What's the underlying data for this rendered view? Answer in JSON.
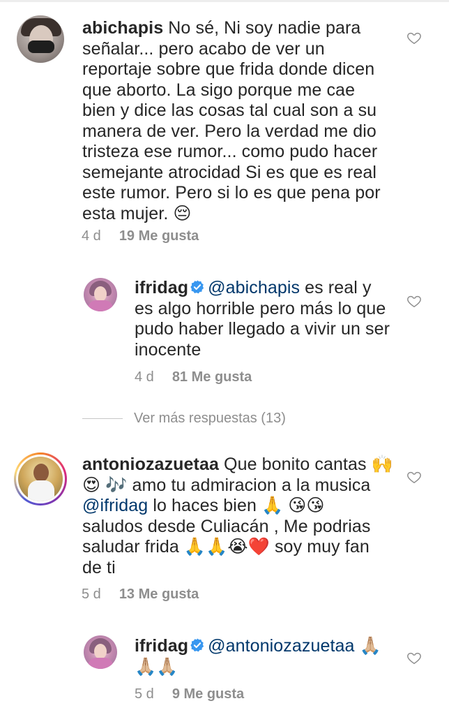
{
  "comments": [
    {
      "username": "abichapis",
      "text_lines": [
        "No sé,  Ni soy nadie para",
        "señalar... pero acabo de ver un",
        "reportaje sobre que frida donde dicen",
        "que aborto.  La sigo porque me cae",
        "bien y dice las cosas tal cual son a su",
        "manera de ver. Pero la verdad me dio",
        "tristeza ese rumor... como pudo hacer",
        "semejante atrocidad Si es que es real",
        "este rumor. Pero si lo es que pena por",
        "esta mujer. 😔"
      ],
      "time": "4 d",
      "likes": "19 Me gusta"
    },
    {
      "username": "ifridag",
      "verified": true,
      "mention": "@abichapis",
      "text_first": " es real y",
      "text_lines": [
        "es algo horrible pero más lo que",
        "pudo haber llegado a vivir un ser",
        "inocente"
      ],
      "time": "4 d",
      "likes": "81 Me gusta"
    },
    {
      "username": "antoniozazuetaa",
      "text_first": "Que bonito cantas 🙌",
      "line2": "😍 🎶 amo tu admiracion a la musica",
      "mention": "@ifridag",
      "line3_rest": " lo haces bien 🙏 😘😘",
      "text_lines": [
        "saludos desde Culiacán , Me podrias",
        "saludar frida 🙏🙏😭❤️ soy muy fan",
        "de ti"
      ],
      "time": "5 d",
      "likes": "13 Me gusta"
    },
    {
      "username": "ifridag",
      "verified": true,
      "mention": "@antoniozazuetaa",
      "text_first": " 🙏🏼",
      "text_lines": [
        "🙏🏼🙏🏼"
      ],
      "time": "5 d",
      "likes": "9 Me gusta"
    }
  ],
  "view_more_replies": "Ver más respuestas (13)",
  "colors": {
    "mention": "#00376b",
    "meta": "#8e8e8e",
    "verified": "#3897f0"
  },
  "icons": [
    "heart-icon",
    "verified-badge-icon"
  ]
}
